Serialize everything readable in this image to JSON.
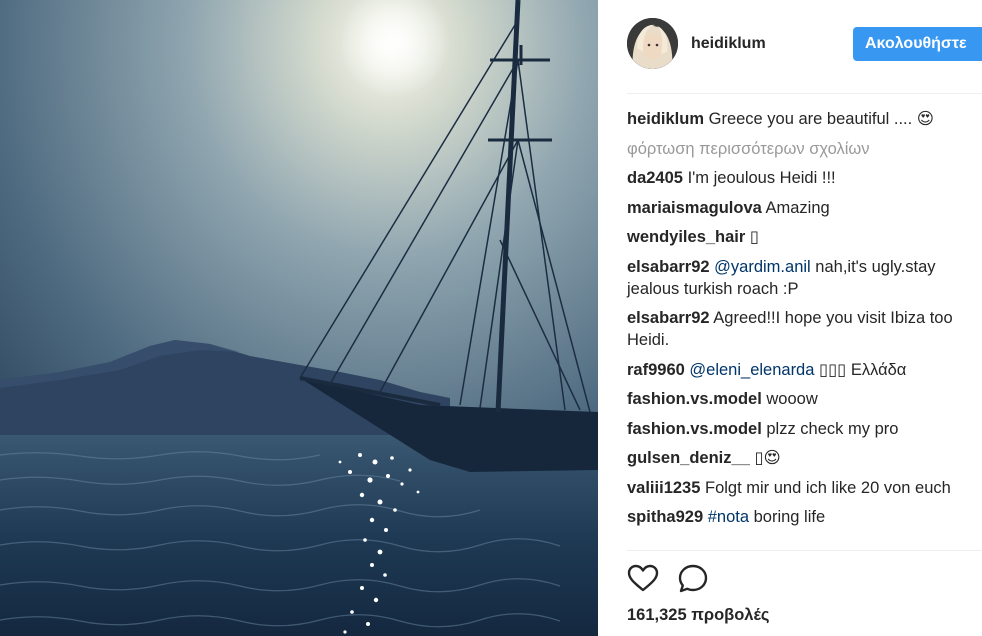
{
  "post": {
    "username": "heidiklum",
    "follow_label": "Ακολουθήστε",
    "load_more_label": "φόρτωση περισσότερων σχολίων",
    "views_label": "161,325 προβολές"
  },
  "comments": [
    {
      "author": "heidiklum",
      "segments": [
        {
          "text": "Greece you are beautiful .... 😍",
          "mention": false
        }
      ]
    },
    {
      "author": "da2405",
      "segments": [
        {
          "text": "I'm jeoulous Heidi !!!",
          "mention": false
        }
      ]
    },
    {
      "author": "mariaismagulova",
      "segments": [
        {
          "text": "Amazing",
          "mention": false
        }
      ]
    },
    {
      "author": "wendyiles_hair",
      "segments": [
        {
          "text": "▯",
          "mention": false
        }
      ]
    },
    {
      "author": "elsabarr92",
      "segments": [
        {
          "text": "@yardim.anil",
          "mention": true
        },
        {
          "text": " nah,it's ugly.stay jealous turkish roach :P",
          "mention": false
        }
      ]
    },
    {
      "author": "elsabarr92",
      "segments": [
        {
          "text": "Agreed!!I hope you visit Ibiza too Heidi.",
          "mention": false
        }
      ]
    },
    {
      "author": "raf9960",
      "segments": [
        {
          "text": "@eleni_elenarda",
          "mention": true
        },
        {
          "text": " ▯▯▯ Ελλάδα",
          "mention": false
        }
      ]
    },
    {
      "author": "fashion.vs.model",
      "segments": [
        {
          "text": "wooow",
          "mention": false
        }
      ]
    },
    {
      "author": "fashion.vs.model",
      "segments": [
        {
          "text": "plzz check my pro",
          "mention": false
        }
      ]
    },
    {
      "author": "gulsen_deniz__",
      "segments": [
        {
          "text": "▯😍",
          "mention": false
        }
      ]
    },
    {
      "author": "valiii1235",
      "segments": [
        {
          "text": "Folgt mir und ich like 20 von euch",
          "mention": false
        }
      ]
    },
    {
      "author": "spitha929",
      "segments": [
        {
          "text": "#nota",
          "mention": true
        },
        {
          "text": " boring life",
          "mention": false
        }
      ]
    }
  ],
  "icons": {
    "like": "heart-icon",
    "comment": "comment-bubble-icon"
  },
  "colors": {
    "follow_button": "#3897f0",
    "mention": "#003569",
    "muted": "#999999"
  }
}
